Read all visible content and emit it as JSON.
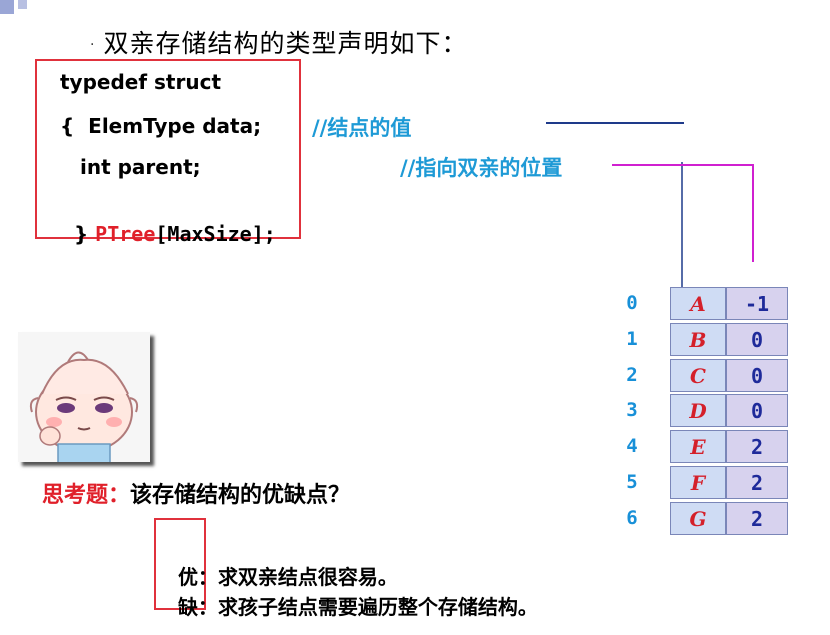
{
  "heading": {
    "bullet": "·",
    "text": "双亲存储结构的类型声明如下："
  },
  "code": {
    "line1": "typedef struct",
    "line2": "{  ElemType data;",
    "line3": "int parent;",
    "line4_brace": "}",
    "line4_type": "PTree",
    "line4_rest": "[MaxSize];"
  },
  "comments": {
    "value": "//结点的值",
    "parent": "//指向双亲的位置"
  },
  "table": {
    "rows": [
      {
        "index": "0",
        "name": "A",
        "parent": "-1"
      },
      {
        "index": "1",
        "name": "B",
        "parent": "0"
      },
      {
        "index": "2",
        "name": "C",
        "parent": "0"
      },
      {
        "index": "3",
        "name": "D",
        "parent": "0"
      },
      {
        "index": "4",
        "name": "E",
        "parent": "2"
      },
      {
        "index": "5",
        "name": "F",
        "parent": "2"
      },
      {
        "index": "6",
        "name": "G",
        "parent": "2"
      }
    ]
  },
  "question": {
    "label": "思考题：",
    "text": "该存储结构的优缺点？"
  },
  "answers": {
    "pro_label": "优：",
    "pro_text": "求双亲结点很容易。",
    "con_label": "缺：",
    "con_text": "求孩子结点需要遍历整个存储结构。"
  },
  "colors": {
    "accent_red": "#e0202a",
    "comment_blue": "#1e9ad6",
    "pointer_magenta": "#d020d0",
    "line_navy": "#1e3a8a"
  }
}
